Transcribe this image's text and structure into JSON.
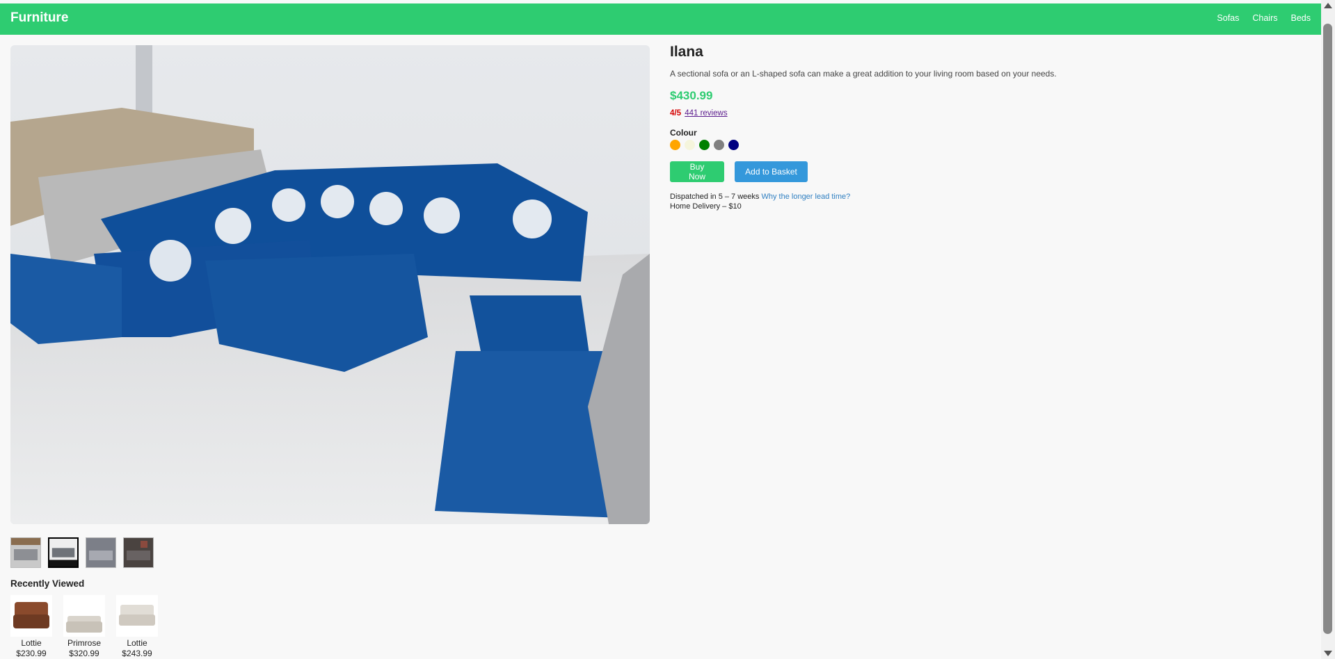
{
  "header": {
    "brand": "Furniture",
    "nav": [
      "Sofas",
      "Chairs",
      "Beds"
    ],
    "accent_color": "#2ecc71"
  },
  "product": {
    "title": "Ilana",
    "description": "A sectional sofa or an L-shaped sofa can make a great addition to your living room based on your needs.",
    "price": "$430.99",
    "rating": "4/5",
    "reviews": "441 reviews",
    "colour_label": "Colour",
    "colours": [
      "#ffa500",
      "#f5f5dc",
      "#008000",
      "#808080",
      "#000080"
    ],
    "buy_label": "Buy Now",
    "basket_label": "Add to Basket",
    "dispatch_text": "Dispatched in 5 – 7 weeks",
    "lead_time_link": "Why the longer lead time?",
    "delivery": "Home Delivery – $10"
  },
  "gallery": {
    "thumbnail_count": 4,
    "active_thumbnail": 2
  },
  "recently_viewed": {
    "title": "Recently Viewed",
    "items": [
      {
        "name": "Lottie",
        "price": "$230.99"
      },
      {
        "name": "Primrose",
        "price": "$320.99"
      },
      {
        "name": "Lottie",
        "price": "$243.99"
      }
    ]
  }
}
